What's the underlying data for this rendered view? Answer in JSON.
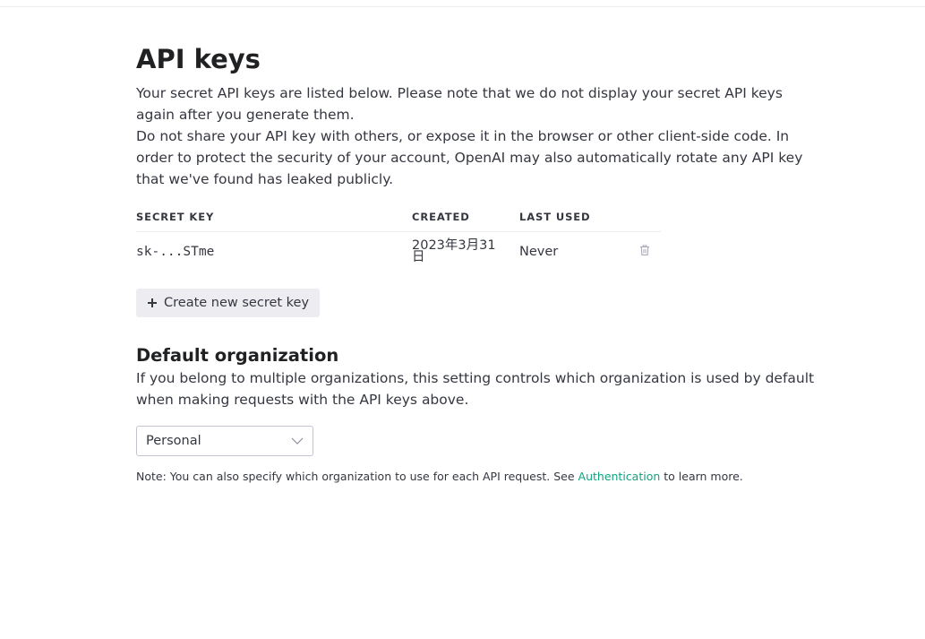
{
  "page": {
    "title": "API keys",
    "intro_1": "Your secret API keys are listed below. Please note that we do not display your secret API keys again after you generate them.",
    "intro_2": "Do not share your API key with others, or expose it in the browser or other client-side code. In order to protect the security of your account, OpenAI may also automatically rotate any API key that we've found has leaked publicly."
  },
  "keys_table": {
    "headers": {
      "secret_key": "SECRET KEY",
      "created": "CREATED",
      "last_used": "LAST USED"
    },
    "rows": [
      {
        "secret_key": "sk-...STme",
        "created": "2023年3月31日",
        "last_used": "Never",
        "action_icon": "trash-icon"
      }
    ]
  },
  "create_button": {
    "label": "Create new secret key",
    "icon": "plus-icon"
  },
  "default_org": {
    "heading": "Default organization",
    "description": "If you belong to multiple organizations, this setting controls which organization is used by default when making requests with the API keys above.",
    "selected": "Personal",
    "note_prefix": "Note: You can also specify which organization to use for each API request. See ",
    "note_link": "Authentication",
    "note_suffix": " to learn more."
  },
  "colors": {
    "link": "#10a37f",
    "button_bg": "#ececf1",
    "text": "#353740",
    "heading": "#202123"
  }
}
